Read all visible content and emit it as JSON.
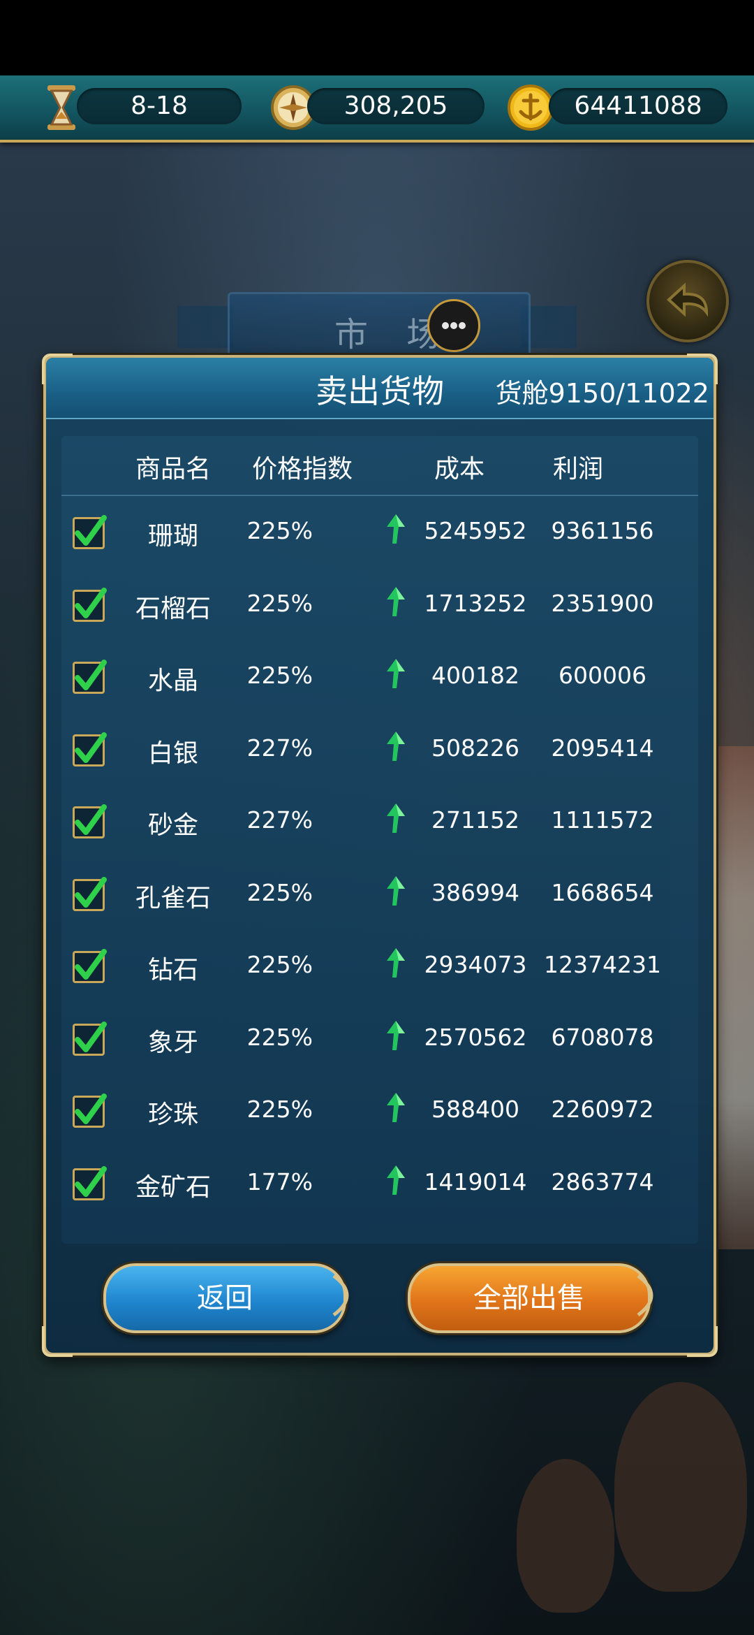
{
  "topbar": {
    "date": "8-18",
    "compass_value": "308,205",
    "gold": "64411088",
    "icons": [
      "hourglass-icon",
      "compass-icon",
      "gold-coin-anchor-icon"
    ]
  },
  "market": {
    "tab_label": "市 场"
  },
  "dialog": {
    "title": "卖出货物",
    "cargo_label": "货舱",
    "cargo_value": "9150/11022",
    "headers": {
      "name": "商品名",
      "price_index": "价格指数",
      "cost": "成本",
      "profit": "利润"
    },
    "rows": [
      {
        "checked": true,
        "name": "珊瑚",
        "index": "225%",
        "trend": "up",
        "cost": "5245952",
        "profit": "9361156"
      },
      {
        "checked": true,
        "name": "石榴石",
        "index": "225%",
        "trend": "up",
        "cost": "1713252",
        "profit": "2351900"
      },
      {
        "checked": true,
        "name": "水晶",
        "index": "225%",
        "trend": "up",
        "cost": "400182",
        "profit": "600006"
      },
      {
        "checked": true,
        "name": "白银",
        "index": "227%",
        "trend": "up",
        "cost": "508226",
        "profit": "2095414"
      },
      {
        "checked": true,
        "name": "砂金",
        "index": "227%",
        "trend": "up",
        "cost": "271152",
        "profit": "1111572"
      },
      {
        "checked": true,
        "name": "孔雀石",
        "index": "225%",
        "trend": "up",
        "cost": "386994",
        "profit": "1668654"
      },
      {
        "checked": true,
        "name": "钻石",
        "index": "225%",
        "trend": "up",
        "cost": "2934073",
        "profit": "12374231"
      },
      {
        "checked": true,
        "name": "象牙",
        "index": "225%",
        "trend": "up",
        "cost": "2570562",
        "profit": "6708078"
      },
      {
        "checked": true,
        "name": "珍珠",
        "index": "225%",
        "trend": "up",
        "cost": "588400",
        "profit": "2260972"
      },
      {
        "checked": true,
        "name": "金矿石",
        "index": "177%",
        "trend": "up",
        "cost": "1419014",
        "profit": "2863774"
      }
    ],
    "buttons": {
      "back": "返回",
      "sell_all": "全部出售"
    }
  },
  "colors": {
    "check_green": "#2fd04a",
    "arrow_green": "#22c55e",
    "back_blue": "#1f86cf",
    "sell_orange": "#e0741a",
    "gold_border": "#c8b27a"
  }
}
